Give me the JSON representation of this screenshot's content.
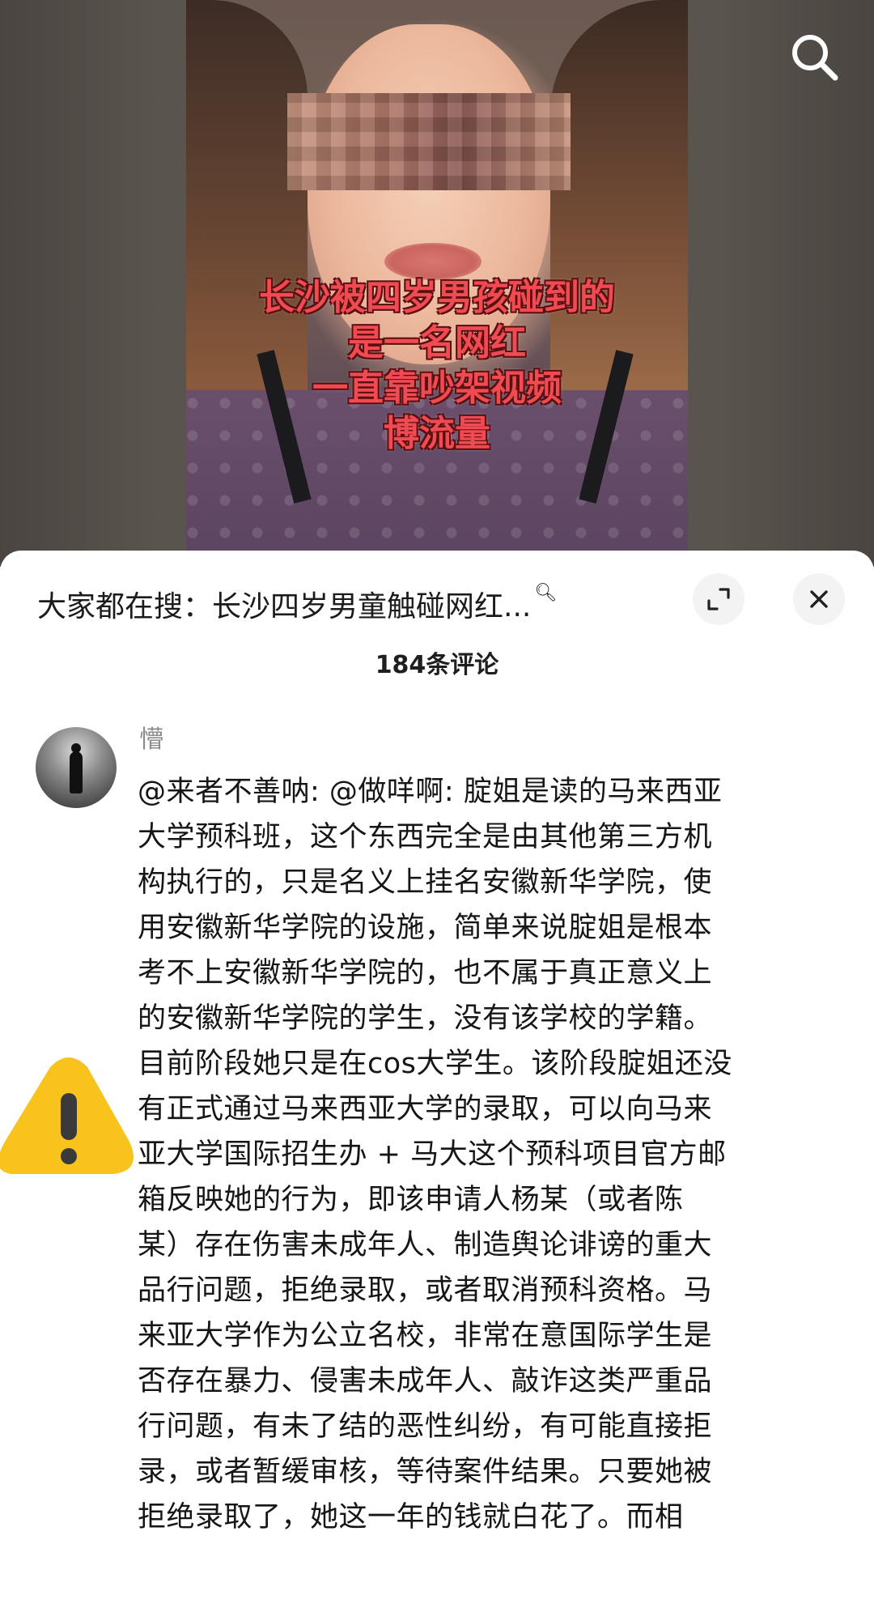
{
  "video": {
    "overlay_lines": [
      "长沙被四岁男孩碰到的",
      "是一名网红",
      "一直靠吵架视频",
      "博流量"
    ]
  },
  "search_icon": "search-icon",
  "sheet": {
    "hot_search": "大家都在搜：长沙四岁男童触碰网红...",
    "expand_icon": "expand-icon",
    "close_icon": "close-icon",
    "comment_count": "184条评论"
  },
  "comment": {
    "username": "懵",
    "lines": [
      "@来者不善呐: @做咩啊: 腚姐是读的马来西亚",
      "大学预科班，这个东西完全是由其他第三方机",
      "构执行的，只是名义上挂名安徽新华学院，使",
      "用安徽新华学院的设施，简单来说腚姐是根本",
      "考不上安徽新华学院的，也不属于真正意义上",
      "的安徽新华学院的学生，没有该学校的学籍。",
      "目前阶段她只是在cos大学生。该阶段腚姐还没",
      "有正式通过马来西亚大学的录取，可以向马来",
      "亚大学国际招生办 + 马大这个预科项目官方邮",
      "箱反映她的行为，即该申请人杨某（或者陈",
      "某）存在伤害未成年人、制造舆论诽谤的重大",
      "品行问题，拒绝录取，或者取消预科资格。马",
      "来亚大学作为公立名校，非常在意国际学生是",
      "否存在暴力、侵害未成年人、敲诈这类严重品",
      "行问题，有未了结的恶性纠纷，有可能直接拒",
      "录，或者暂缓审核，等待案件结果。只要她被",
      "拒绝录取了，她这一年的钱就白花了。而相"
    ]
  },
  "colors": {
    "overlay_text": "#f04a52",
    "warning_yellow": "#f7c31c",
    "text_primary": "#161616",
    "text_secondary": "#8b8b8b"
  }
}
